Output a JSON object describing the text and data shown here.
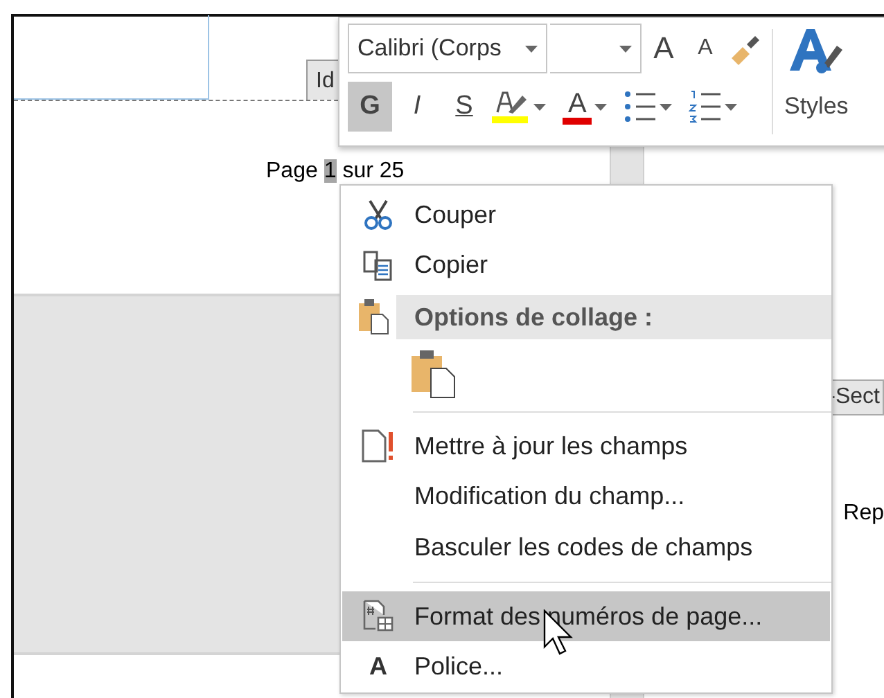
{
  "document": {
    "header_tab": "Id",
    "footer": {
      "prefix": "Page",
      "field": "1",
      "suffix": "sur 25"
    },
    "section_tab": "-Sect",
    "side_text": "Rep"
  },
  "mini_toolbar": {
    "font_name": "Calibri (Corps",
    "grow_font": "A",
    "shrink_font": "A",
    "format_buttons": [
      {
        "label": "G",
        "selected": true
      },
      {
        "label": "I",
        "selected": false
      },
      {
        "label": "S",
        "selected": false
      }
    ],
    "font_color": "A",
    "styles_label": "Styles"
  },
  "context_menu": [
    {
      "kind": "command",
      "label": "Couper",
      "selected": false
    },
    {
      "kind": "command",
      "label": "Copier",
      "selected": false
    },
    {
      "kind": "header",
      "label": "Options de collage :"
    },
    {
      "kind": "paste"
    },
    {
      "kind": "separator"
    },
    {
      "kind": "command",
      "label": "Mettre à jour les champs",
      "selected": false
    },
    {
      "kind": "command",
      "label": "Modification du champ...",
      "selected": false
    },
    {
      "kind": "command",
      "label": "Basculer les codes de champs",
      "selected": false
    },
    {
      "kind": "separator"
    },
    {
      "kind": "command",
      "label": "Format des numéros de page...",
      "selected": true
    },
    {
      "kind": "command",
      "label": "Police...",
      "icon_text": "A",
      "selected": false
    }
  ]
}
